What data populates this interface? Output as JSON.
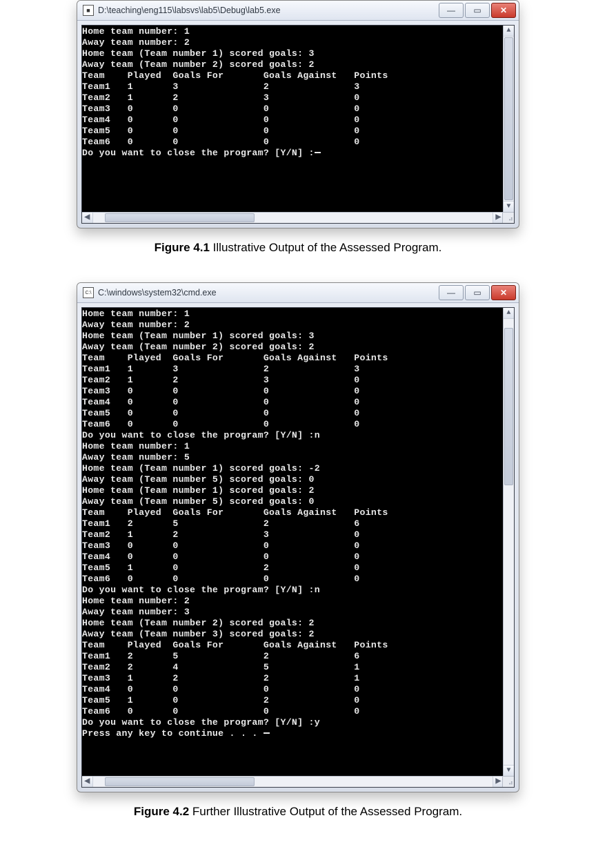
{
  "figure1": {
    "window_title": "D:\\teaching\\eng115\\labsvs\\lab5\\Debug\\lab5.exe",
    "app_icon_label": "■",
    "console_lines": [
      "Home team number: 1",
      "Away team number: 2",
      "Home team (Team number 1) scored goals: 3",
      "Away team (Team number 2) scored goals: 2",
      "Team    Played  Goals For       Goals Against   Points",
      "Team1   1       3               2               3",
      "Team2   1       2               3               0",
      "Team3   0       0               0               0",
      "Team4   0       0               0               0",
      "Team5   0       0               0               0",
      "Team6   0       0               0               0",
      "Do you want to close the program? [Y/N] :"
    ],
    "trailing_lines": [
      "",
      "",
      "",
      "",
      ""
    ],
    "caption_bold": "Figure 4.1",
    "caption_rest": "  Illustrative Output of the Assessed Program.",
    "h_thumb": {
      "left": "3%",
      "width": "37%"
    },
    "v_thumb_full": true
  },
  "figure2": {
    "window_title": "C:\\windows\\system32\\cmd.exe",
    "app_icon_label": "C:\\",
    "console_lines": [
      "Home team number: 1",
      "Away team number: 2",
      "Home team (Team number 1) scored goals: 3",
      "Away team (Team number 2) scored goals: 2",
      "Team    Played  Goals For       Goals Against   Points",
      "Team1   1       3               2               3",
      "Team2   1       2               3               0",
      "Team3   0       0               0               0",
      "Team4   0       0               0               0",
      "Team5   0       0               0               0",
      "Team6   0       0               0               0",
      "Do you want to close the program? [Y/N] :n",
      "Home team number: 1",
      "Away team number: 5",
      "Home team (Team number 1) scored goals: -2",
      "Away team (Team number 5) scored goals: 0",
      "Home team (Team number 1) scored goals: 2",
      "Away team (Team number 5) scored goals: 0",
      "Team    Played  Goals For       Goals Against   Points",
      "Team1   2       5               2               6",
      "Team2   1       2               3               0",
      "Team3   0       0               0               0",
      "Team4   0       0               0               0",
      "Team5   1       0               2               0",
      "Team6   0       0               0               0",
      "Do you want to close the program? [Y/N] :n",
      "Home team number: 2",
      "Away team number: 3",
      "Home team (Team number 2) scored goals: 2",
      "Away team (Team number 3) scored goals: 2",
      "Team    Played  Goals For       Goals Against   Points",
      "Team1   2       5               2               6",
      "Team2   2       4               5               1",
      "Team3   1       2               2               1",
      "Team4   0       0               0               0",
      "Team5   1       0               2               0",
      "Team6   0       0               0               0",
      "Do you want to close the program? [Y/N] :y",
      "Press any key to continue . . . "
    ],
    "trailing_lines": [
      "",
      "",
      ""
    ],
    "caption_bold": "Figure 4.2",
    "caption_rest": "  Further Illustrative Output of the Assessed Program.",
    "h_thumb": {
      "left": "3%",
      "width": "37%"
    },
    "v_thumb": {
      "top": "2%",
      "height": "35%"
    }
  },
  "win_buttons": {
    "minimize": "—",
    "maximize": "▭",
    "close": "✕"
  },
  "scroll_arrows": {
    "up": "▲",
    "down": "▼",
    "left": "◀",
    "right": "▶"
  }
}
